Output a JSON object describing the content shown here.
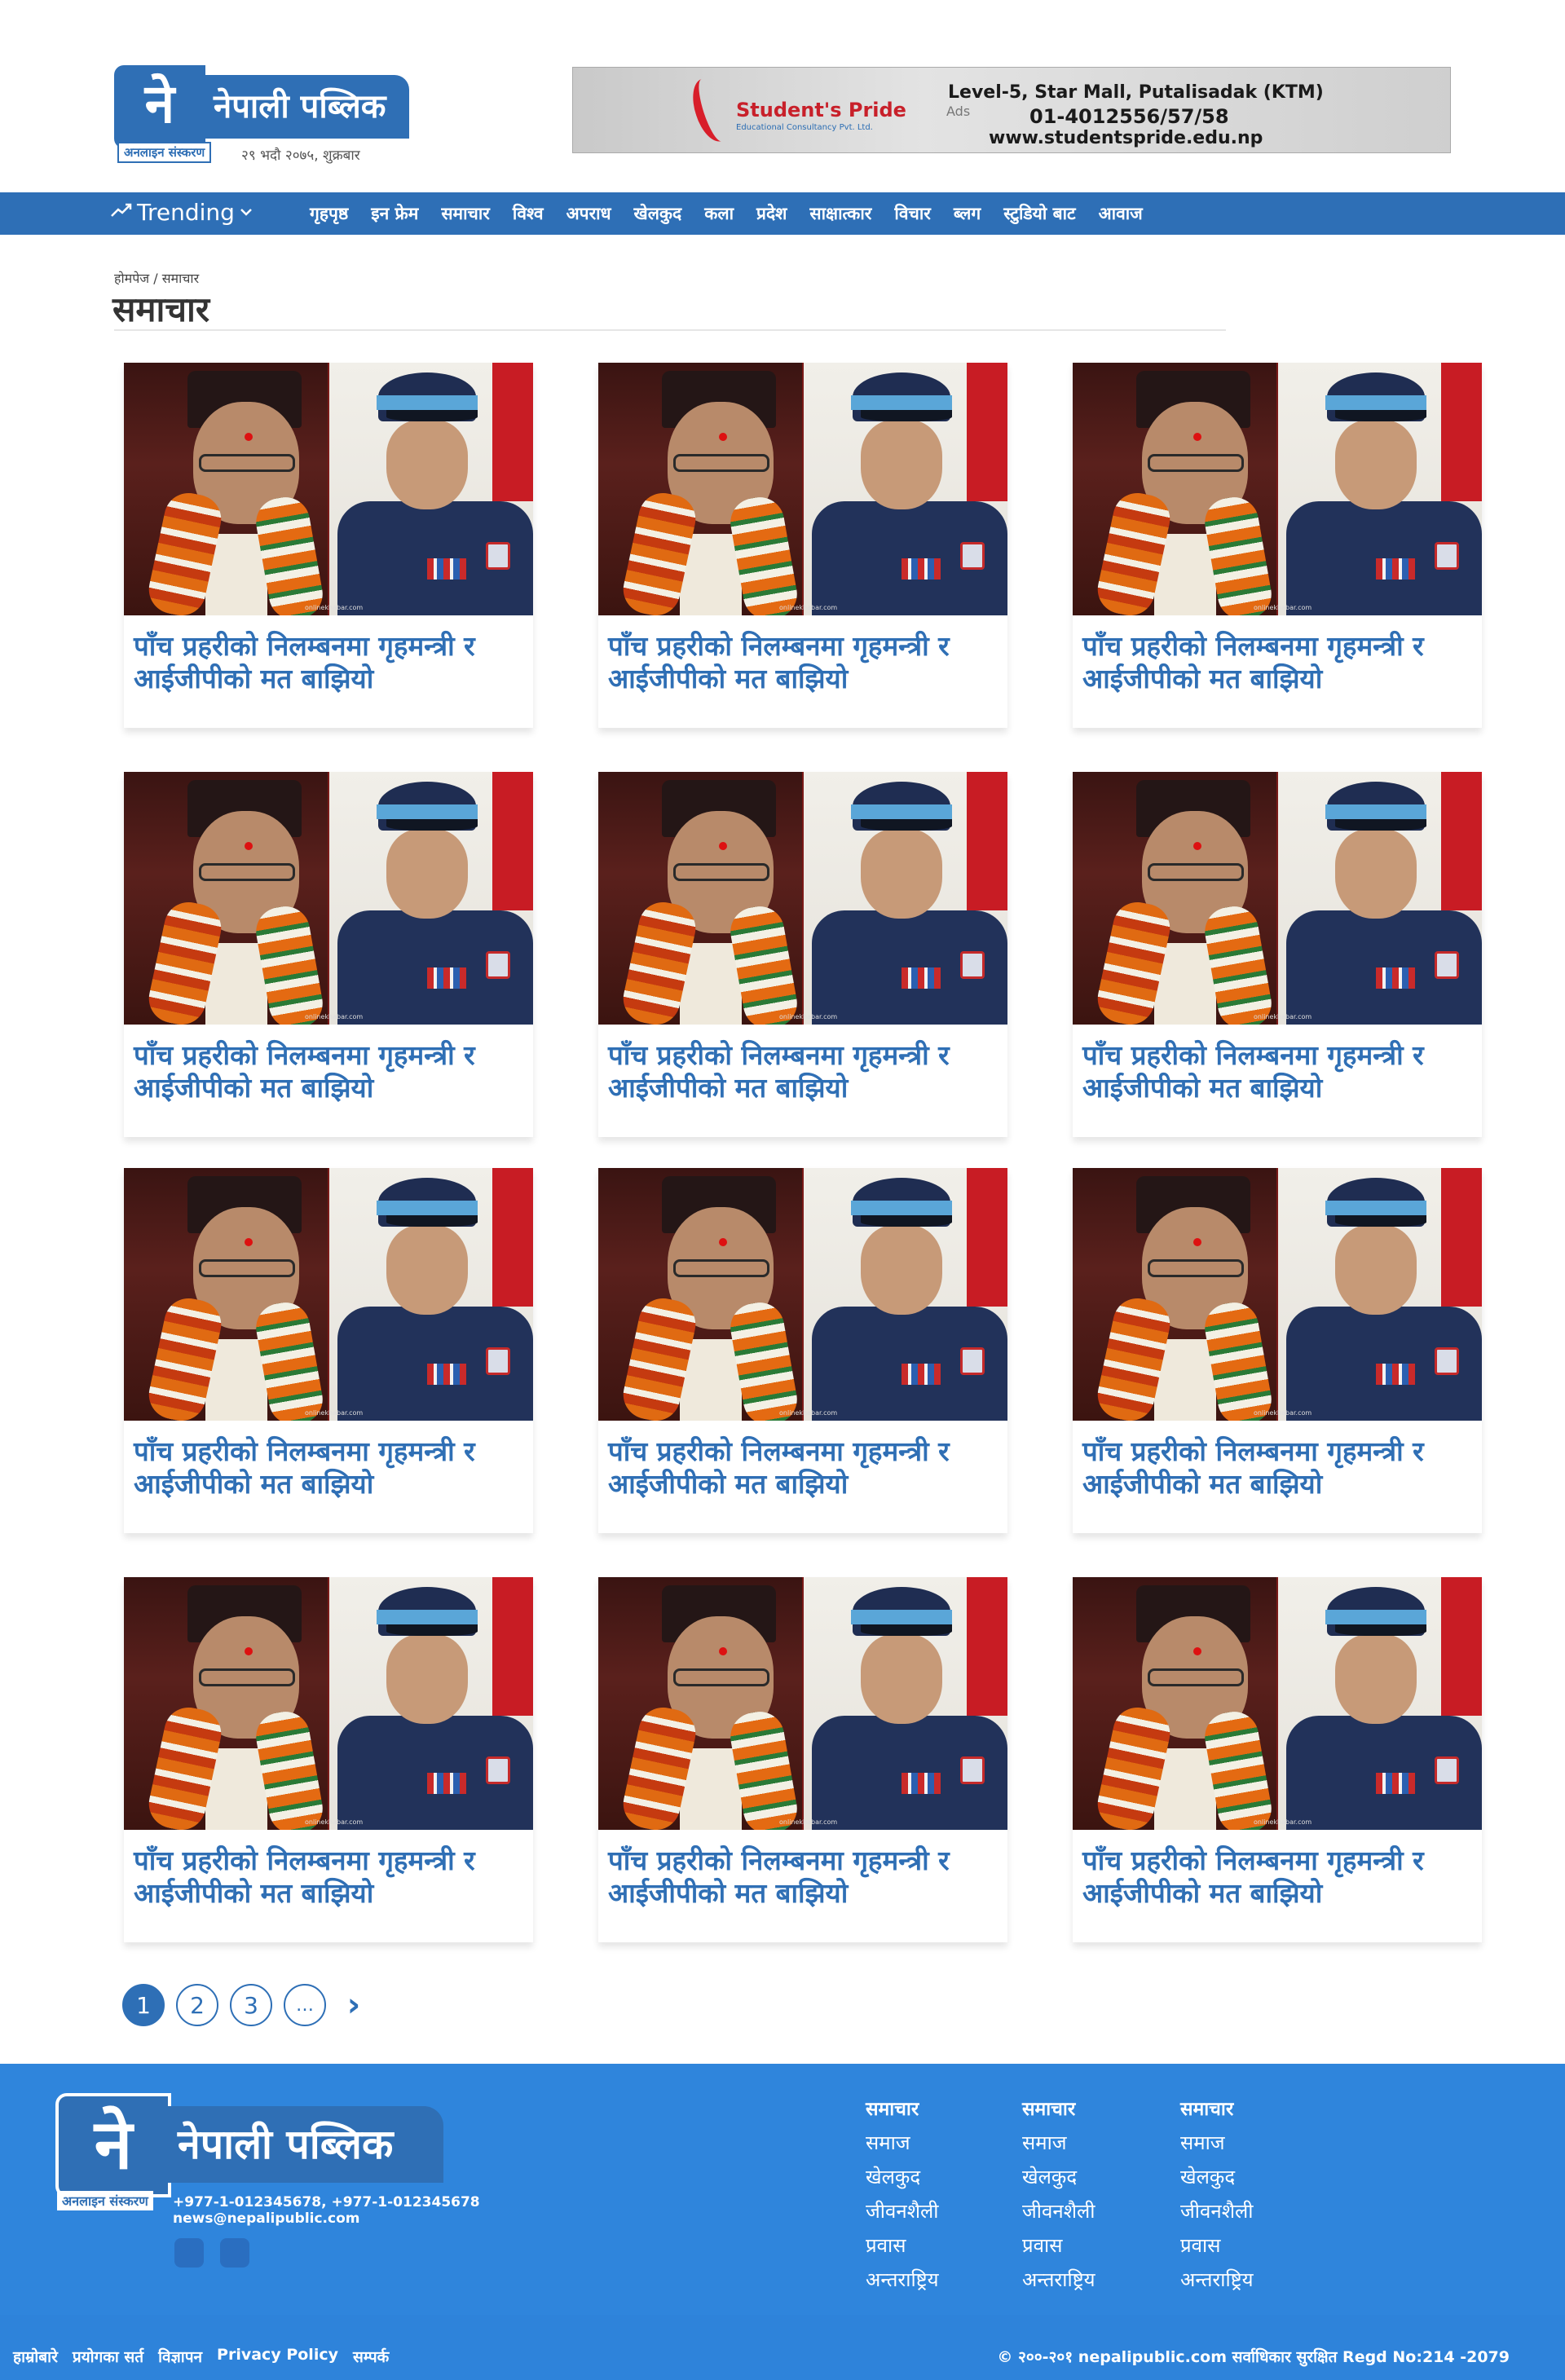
{
  "header": {
    "logo_mark": "ने",
    "logo_name": "नेपाली पब्लिक",
    "logo_sub": "अनलाइन संस्करण",
    "date": "२९ भदौ २०७५, शुक्रबार"
  },
  "ad": {
    "brand": "Student's Pride",
    "brand_sub": "Educational Consultancy Pvt. Ltd.",
    "label": "Ads",
    "line1": "Level-5, Star Mall, Putalisadak (KTM)",
    "line2": "01-4012556/57/58",
    "line3": "www.studentspride.edu.np"
  },
  "nav": {
    "trending_label": "Trending",
    "items": [
      {
        "label": "गृहपृष्ठ"
      },
      {
        "label": "इन फ्रेम"
      },
      {
        "label": "समाचार"
      },
      {
        "label": "विश्व"
      },
      {
        "label": "अपराध"
      },
      {
        "label": "खेलकुद"
      },
      {
        "label": "कला"
      },
      {
        "label": "प्रदेश"
      },
      {
        "label": "साक्षात्कार"
      },
      {
        "label": "विचार"
      },
      {
        "label": "ब्लग"
      },
      {
        "label": "स्टुडियो बाट"
      },
      {
        "label": "आवाज"
      }
    ]
  },
  "breadcrumb": "होमपेज / समाचार",
  "page_title": "समाचार",
  "articles": [
    {
      "title": "पाँच प्रहरीको निलम्बनमा गृहमन्त्री र आईजीपीको मत बाझियो",
      "watermark": "onlinekhabar.com"
    },
    {
      "title": "पाँच प्रहरीको निलम्बनमा गृहमन्त्री र आईजीपीको मत बाझियो",
      "watermark": "onlinekhabar.com"
    },
    {
      "title": "पाँच प्रहरीको निलम्बनमा गृहमन्त्री र आईजीपीको मत बाझियो",
      "watermark": "onlinekhabar.com"
    },
    {
      "title": "पाँच प्रहरीको निलम्बनमा गृहमन्त्री र आईजीपीको मत बाझियो",
      "watermark": "onlinekhabar.com"
    },
    {
      "title": "पाँच प्रहरीको निलम्बनमा गृहमन्त्री र आईजीपीको मत बाझियो",
      "watermark": "onlinekhabar.com"
    },
    {
      "title": "पाँच प्रहरीको निलम्बनमा गृहमन्त्री र आईजीपीको मत बाझियो",
      "watermark": "onlinekhabar.com"
    },
    {
      "title": "पाँच प्रहरीको निलम्बनमा गृहमन्त्री र आईजीपीको मत बाझियो",
      "watermark": "onlinekhabar.com"
    },
    {
      "title": "पाँच प्रहरीको निलम्बनमा गृहमन्त्री र आईजीपीको मत बाझियो",
      "watermark": "onlinekhabar.com"
    },
    {
      "title": "पाँच प्रहरीको निलम्बनमा गृहमन्त्री र आईजीपीको मत बाझियो",
      "watermark": "onlinekhabar.com"
    },
    {
      "title": "पाँच प्रहरीको निलम्बनमा गृहमन्त्री र आईजीपीको मत बाझियो",
      "watermark": "onlinekhabar.com"
    },
    {
      "title": "पाँच प्रहरीको निलम्बनमा गृहमन्त्री र आईजीपीको मत बाझियो",
      "watermark": "onlinekhabar.com"
    },
    {
      "title": "पाँच प्रहरीको निलम्बनमा गृहमन्त्री र आईजीपीको मत बाझियो",
      "watermark": "onlinekhabar.com"
    }
  ],
  "pagination": {
    "pages": [
      "1",
      "2",
      "3",
      "…"
    ],
    "current": "1",
    "next_icon": "chevron-right-icon",
    "next_glyph": "›"
  },
  "footer": {
    "logo_mark": "ने",
    "logo_name": "नेपाली पब्लिक",
    "logo_sub": "अनलाइन संस्करण",
    "phone": "+977-1-012345678, +977-1-012345678",
    "email": "news@nepalipublic.com",
    "columns": [
      {
        "heading": "समाचार",
        "links": [
          "समाज",
          "खेलकुद",
          "जीवनशैली",
          "प्रवास",
          "अन्तराष्ट्रिय"
        ]
      },
      {
        "heading": "समाचार",
        "links": [
          "समाज",
          "खेलकुद",
          "जीवनशैली",
          "प्रवास",
          "अन्तराष्ट्रिय"
        ]
      },
      {
        "heading": "समाचार",
        "links": [
          "समाज",
          "खेलकुद",
          "जीवनशैली",
          "प्रवास",
          "अन्तराष्ट्रिय"
        ]
      }
    ],
    "bottom_links": [
      "हाम्रोबारे",
      "प्रयोगका सर्त",
      "विज्ञापन",
      "Privacy Policy",
      "सम्पर्क"
    ],
    "copyright": "© २००-२०१ nepalipublic.com सर्वाधिकार सुरक्षित Regd No:214 -2079"
  },
  "colors": {
    "brand_blue": "#2e6fb6",
    "footer_blue": "#2f85dc",
    "title_blue": "#2f6fb5"
  }
}
